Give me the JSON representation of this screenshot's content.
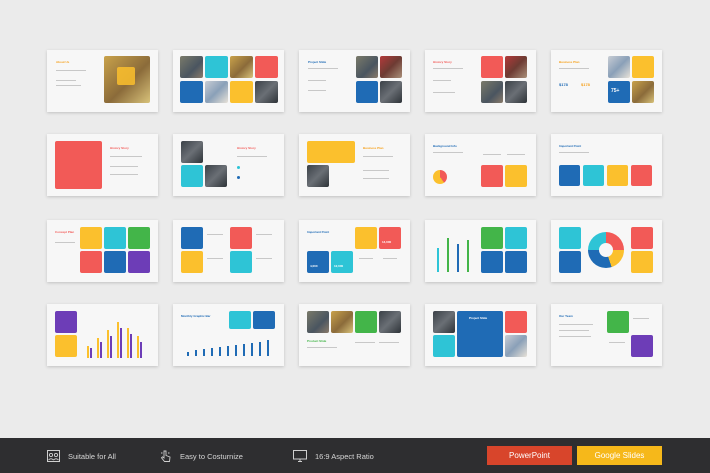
{
  "slides": {
    "about_us": "About Us",
    "project_slide": "Project Slide",
    "history_story": "History Story",
    "business_plan": "Business Plan",
    "background_info": "Background Info",
    "important_point": "Important Point",
    "concept_plan": "Concept Plan",
    "monthly_growth": "Monthly Graphic Bar",
    "product_slide": "Product Slide",
    "our_team": "Our Team",
    "stat_1": "$178",
    "stat_2": "75+",
    "stat_3": "14,000",
    "stat_4": "4,000",
    "stat_5": "12,000"
  },
  "footer": {
    "features": [
      {
        "icon": "users-icon",
        "label": "Suitable for All"
      },
      {
        "icon": "pointer-icon",
        "label": "Easy to Costurnize"
      },
      {
        "icon": "monitor-icon",
        "label": "16:9 Aspect Ratio"
      }
    ],
    "buttons": {
      "powerpoint": "PowerPoint",
      "google_slides": "Google Slides"
    }
  },
  "colors": {
    "red": "#f25a57",
    "cyan": "#2ec4d6",
    "yellow": "#fbc02d",
    "blue": "#1f6bb5",
    "green": "#43b549",
    "purple": "#6d3db7",
    "footer_bg": "#2e2e30",
    "powerpoint": "#d8452b",
    "google_slides": "#f6b81a"
  }
}
